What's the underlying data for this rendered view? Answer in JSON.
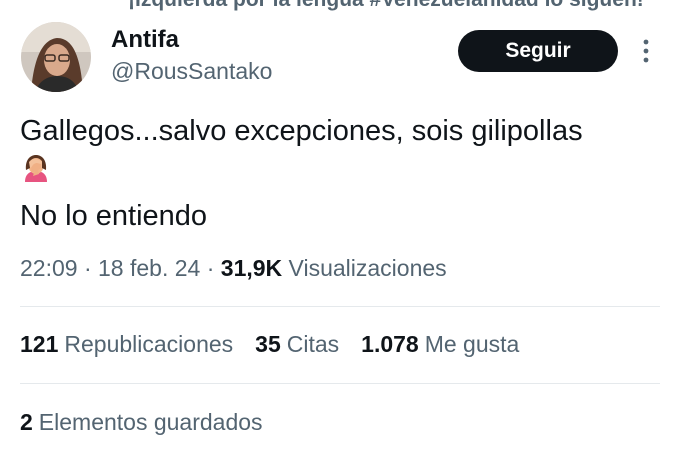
{
  "top_cut_text": "¡Izquierda por la lengua #Venezuelanidad lo siguen!",
  "author": {
    "name": "Antifa",
    "handle": "@RousSantako"
  },
  "follow_label": "Seguir",
  "tweet": {
    "line1": "Gallegos...salvo excepciones, sois gilipollas",
    "line3": "No lo entiendo"
  },
  "meta": {
    "time": "22:09",
    "sep1": " · ",
    "date": "18 feb. 24",
    "sep2": " · ",
    "views_count": "31,9K",
    "views_label": "Visualizaciones"
  },
  "stats": [
    {
      "num": "121",
      "label": "Republicaciones"
    },
    {
      "num": "35",
      "label": "Citas"
    },
    {
      "num": "1.078",
      "label": "Me gusta"
    }
  ],
  "bookmarks": {
    "num": "2",
    "label": "Elementos guardados"
  },
  "icons": {
    "more": "more-vertical-icon",
    "facepalm": "woman-facepalming-emoji"
  }
}
